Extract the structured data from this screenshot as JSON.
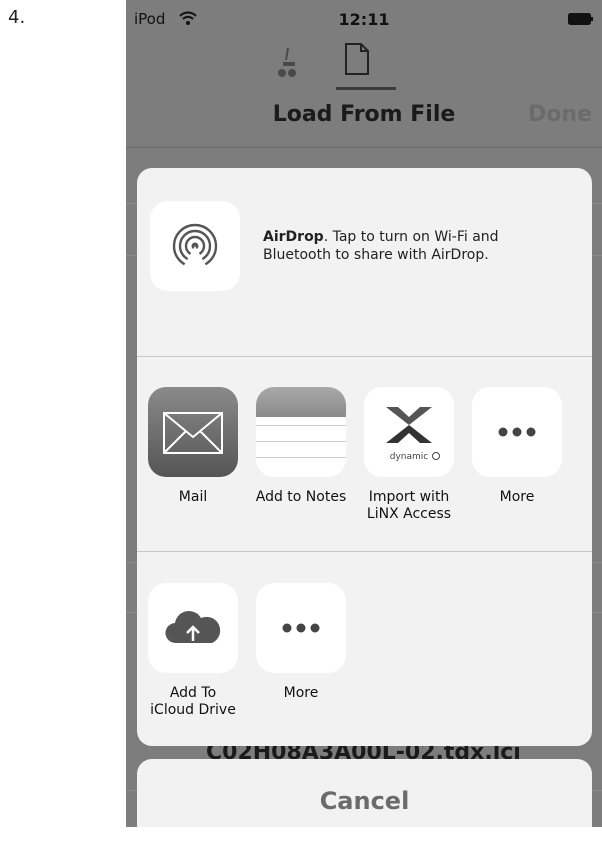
{
  "step_number": "4.",
  "status_bar": {
    "carrier": "iPod",
    "time": "12:11",
    "wifi_icon": "wifi-icon",
    "battery_icon": "battery-icon"
  },
  "nav": {
    "title": "Load From File",
    "done_label": "Done",
    "tabs": [
      {
        "icon": "wheelchair-icon",
        "selected": false
      },
      {
        "icon": "file-icon",
        "selected": true
      }
    ]
  },
  "share_sheet": {
    "airdrop": {
      "title": "AirDrop",
      "description": ". Tap to turn on Wi-Fi and Bluetooth to share with AirDrop.",
      "icon": "airdrop-icon"
    },
    "apps": [
      {
        "label_line1": "Mail",
        "label_line2": "",
        "icon": "mail-icon"
      },
      {
        "label_line1": "Add to Notes",
        "label_line2": "",
        "icon": "notes-icon"
      },
      {
        "label_line1": "Import with",
        "label_line2": "LiNX Access",
        "icon": "dynamic-logo-icon",
        "logo_text": "dynamic"
      },
      {
        "label_line1": "More",
        "label_line2": "",
        "icon": "more-dots-icon"
      }
    ],
    "actions": [
      {
        "label_line1": "Add To",
        "label_line2": "iCloud Drive",
        "icon": "cloud-upload-icon"
      },
      {
        "label_line1": "More",
        "label_line2": "",
        "icon": "more-dots-icon"
      }
    ]
  },
  "background_file": "C02H08A3A00L-02.tdx.lci",
  "cancel_label": "Cancel",
  "colors": {
    "dim_background": "#7d7d7d",
    "sheet_background": "#f2f2f2",
    "icon_tile": "#ffffff"
  }
}
